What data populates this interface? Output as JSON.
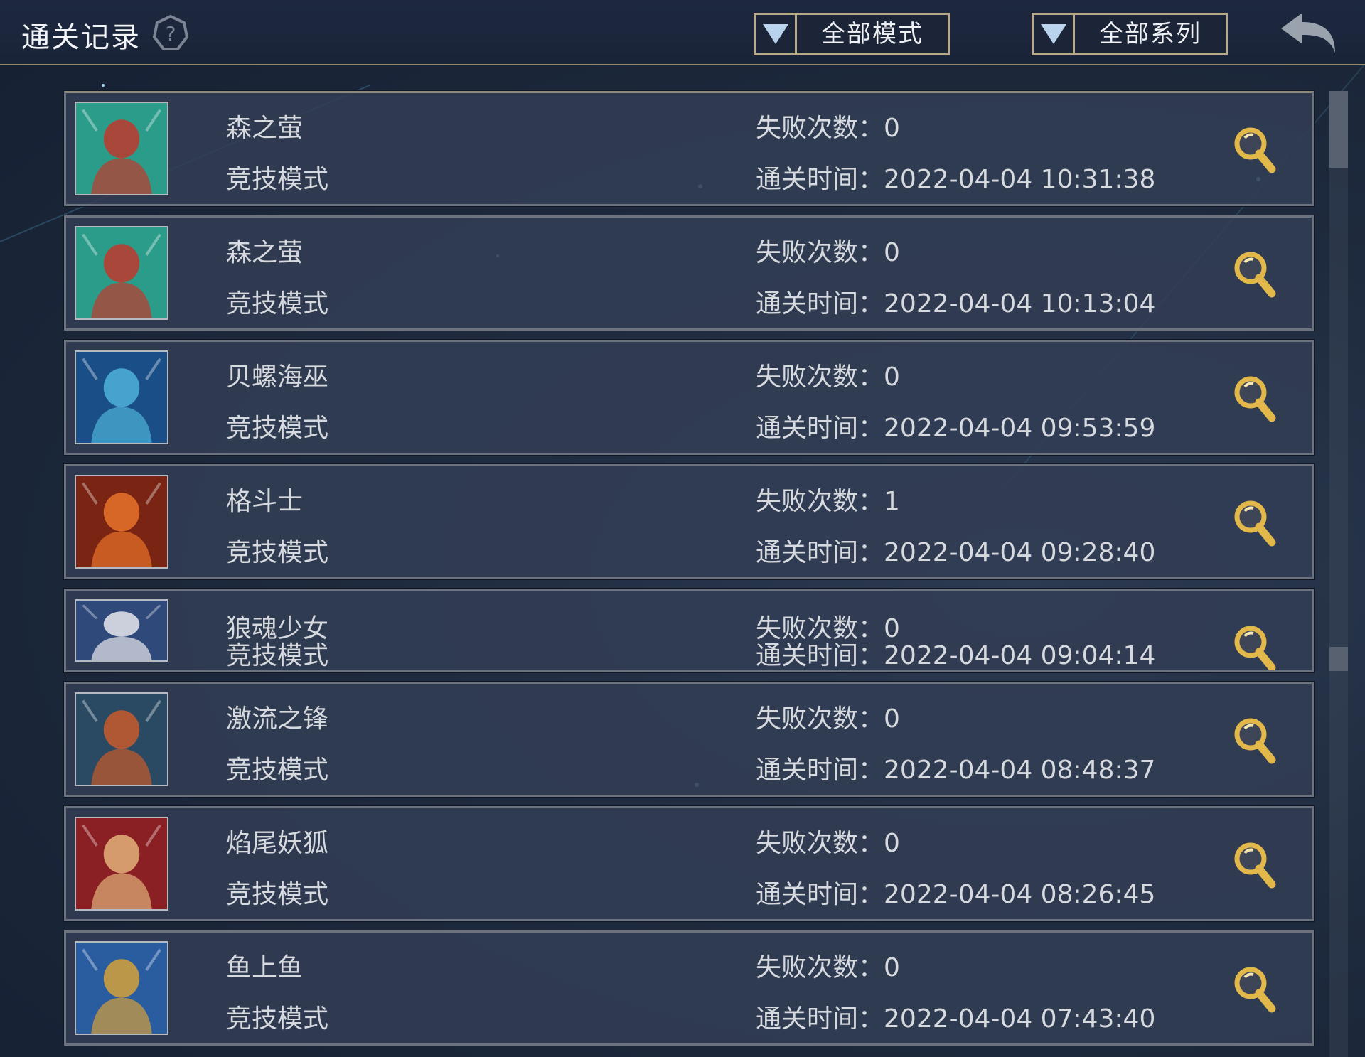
{
  "header": {
    "title": "通关记录",
    "filter_mode": "全部模式",
    "filter_series": "全部系列"
  },
  "labels": {
    "fail_prefix": "失败次数：",
    "time_prefix": "通关时间："
  },
  "records": [
    {
      "name": "森之萤",
      "mode": "竞技模式",
      "fail_count": "0",
      "clear_time": "2022-04-04 10:31:38",
      "avatar_colors": [
        "#2c9c8a",
        "#c0392b"
      ]
    },
    {
      "name": "森之萤",
      "mode": "竞技模式",
      "fail_count": "0",
      "clear_time": "2022-04-04 10:13:04",
      "avatar_colors": [
        "#2c9c8a",
        "#c0392b"
      ]
    },
    {
      "name": "贝螺海巫",
      "mode": "竞技模式",
      "fail_count": "0",
      "clear_time": "2022-04-04 09:53:59",
      "avatar_colors": [
        "#1a4e86",
        "#4fb3d9"
      ]
    },
    {
      "name": "格斗士",
      "mode": "竞技模式",
      "fail_count": "1",
      "clear_time": "2022-04-04 09:28:40",
      "avatar_colors": [
        "#7a2413",
        "#e8732a"
      ]
    },
    {
      "name": "狼魂少女",
      "mode": "竞技模式",
      "fail_count": "0",
      "clear_time": "2022-04-04 09:04:14",
      "avatar_colors": [
        "#2f4a7a",
        "#e8e8ee"
      ]
    },
    {
      "name": "激流之锋",
      "mode": "竞技模式",
      "fail_count": "0",
      "clear_time": "2022-04-04 08:48:37",
      "avatar_colors": [
        "#2a4a63",
        "#c75a2a"
      ]
    },
    {
      "name": "焰尾妖狐",
      "mode": "竞技模式",
      "fail_count": "0",
      "clear_time": "2022-04-04 08:26:45",
      "avatar_colors": [
        "#8a1f24",
        "#e2b27a"
      ]
    },
    {
      "name": "鱼上鱼",
      "mode": "竞技模式",
      "fail_count": "0",
      "clear_time": "2022-04-04 07:43:40",
      "avatar_colors": [
        "#2a5ca0",
        "#d4a13a"
      ]
    }
  ],
  "icons": {
    "help": "help-icon",
    "back": "back-arrow-icon",
    "dropdown": "dropdown-arrow-icon",
    "detail": "magnifier-icon"
  },
  "colors": {
    "accent_gold": "#e2b84a",
    "border_tan": "#b8a98a"
  }
}
